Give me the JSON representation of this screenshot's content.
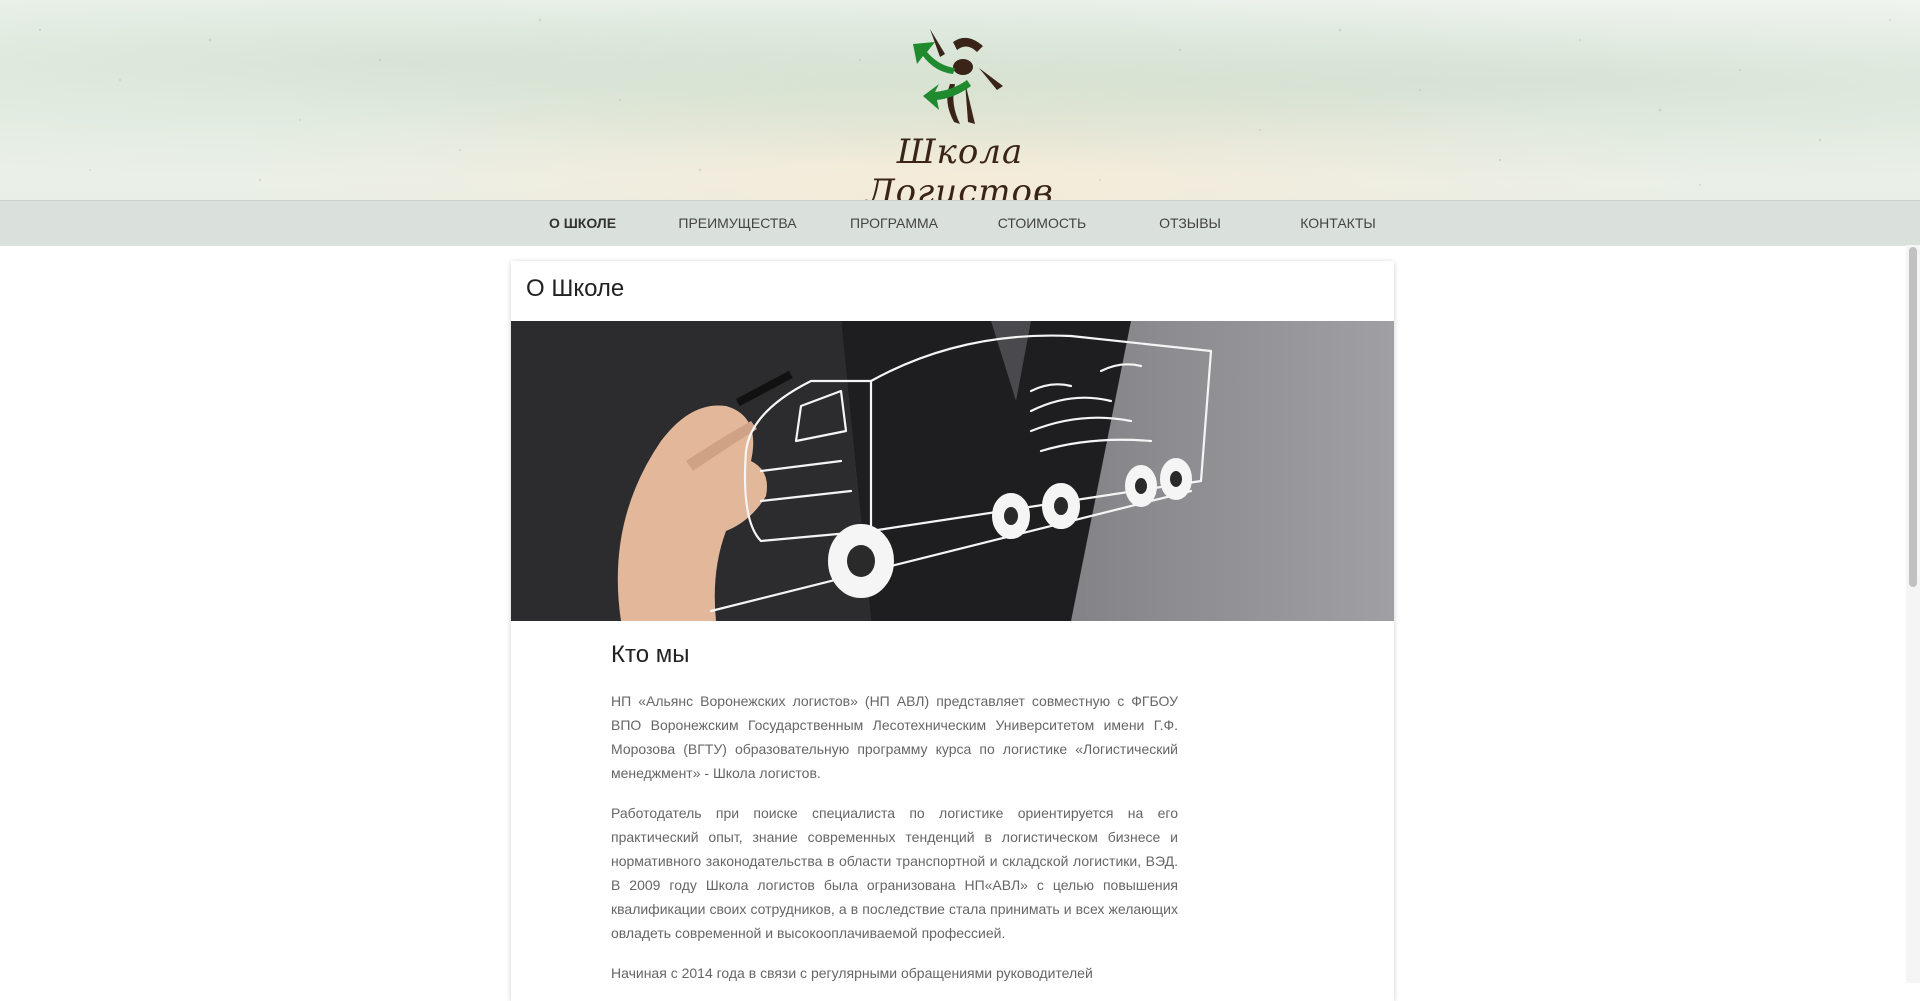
{
  "header": {
    "logo_icon": "logistics-arrows-logo",
    "logo_text": "Школа Логистов"
  },
  "nav": {
    "items": [
      {
        "label": "О ШКОЛЕ",
        "active": true
      },
      {
        "label": "ПРЕИМУЩЕСТВА",
        "active": false
      },
      {
        "label": "ПРОГРАММА",
        "active": false
      },
      {
        "label": "СТОИМОСТЬ",
        "active": false
      },
      {
        "label": "ОТЗЫВЫ",
        "active": false
      },
      {
        "label": "КОНТАКТЫ",
        "active": false
      }
    ]
  },
  "main": {
    "card_title": "О Школе",
    "hero_image": "hand-drawing-truck-illustration",
    "section_heading": "Кто мы",
    "paragraphs": [
      "НП «Альянс Воронежских логистов» (НП АВЛ) представляет совместную с ФГБОУ ВПО Воронежским Государственным Лесотехническим Университетом имени Г.Ф. Морозова (ВГТУ) образовательную программу курса по логистике «Логистический менеджмент» - Школа логистов.",
      "Работодатель при поиске специалиста по логистике ориентируется на его практический опыт, знание современных тенденций в логистическом бизнесе и нормативного законодательства в области транспортной и складской логистики, ВЭД. В 2009 году Школа логистов была огранизована НП«АВЛ» с целью повышения квалификации своих сотрудников, а в последствие стала принимать и всех желающих овладеть современной и высокооплачиваемой профессией.",
      "Начиная с 2014 года в связи с регулярными обращениями руководителей"
    ]
  },
  "colors": {
    "logo_green": "#1f8a2e",
    "logo_brown": "#3a2418",
    "nav_bg": "#d3dbd5",
    "text_body": "#666666"
  }
}
